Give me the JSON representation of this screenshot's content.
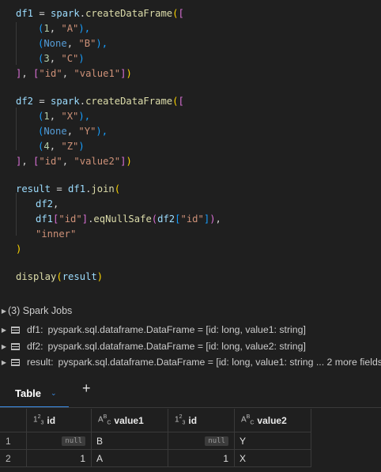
{
  "code": {
    "l1": [
      "df1",
      " = ",
      "spark",
      ".",
      "createDataFrame",
      "(",
      "["
    ],
    "l2": [
      "(",
      "1",
      ", ",
      "\"A\"",
      "),"
    ],
    "l3": [
      "(",
      "None",
      ", ",
      "\"B\"",
      "),"
    ],
    "l4": [
      "(",
      "3",
      ", ",
      "\"C\"",
      ")"
    ],
    "l5": [
      "]",
      ", ",
      "[",
      "\"id\"",
      ", ",
      "\"value1\"",
      "]",
      ")"
    ],
    "l6": [
      "df2",
      " = ",
      "spark",
      ".",
      "createDataFrame",
      "(",
      "["
    ],
    "l7": [
      "(",
      "1",
      ", ",
      "\"X\"",
      "),"
    ],
    "l8": [
      "(",
      "None",
      ", ",
      "\"Y\"",
      "),"
    ],
    "l9": [
      "(",
      "4",
      ", ",
      "\"Z\"",
      ")"
    ],
    "l10": [
      "]",
      ", ",
      "[",
      "\"id\"",
      ", ",
      "\"value2\"",
      "]",
      ")"
    ],
    "l11": [
      "result",
      " = ",
      "df1",
      ".",
      "join",
      "("
    ],
    "l12": [
      "df2",
      ","
    ],
    "l13": [
      "df1",
      "[",
      "\"id\"",
      "]",
      ".",
      "eqNullSafe",
      "(",
      "df2",
      "[",
      "\"id\"",
      "]",
      ")",
      ","
    ],
    "l14": [
      "\"inner\""
    ],
    "l15": [
      ")"
    ],
    "l16": [
      "display",
      "(",
      "result",
      ")"
    ]
  },
  "jobs": {
    "label": "(3) Spark Jobs"
  },
  "dataframes": [
    {
      "name": "df1:",
      "type": "pyspark.sql.dataframe.DataFrame = [id: long, value1: string]"
    },
    {
      "name": "df2:",
      "type": "pyspark.sql.dataframe.DataFrame = [id: long, value2: string]"
    },
    {
      "name": "result:",
      "type": "pyspark.sql.dataframe.DataFrame = [id: long, value1: string ... 2 more fields]"
    }
  ],
  "tabs": {
    "table_label": "Table",
    "add_symbol": "+"
  },
  "table": {
    "columns": [
      {
        "type_main": "1",
        "type_sup": "2",
        "type_sub": "3",
        "name": "id"
      },
      {
        "type_main": "A",
        "type_sup": "B",
        "type_sub": "C",
        "name": "value1"
      },
      {
        "type_main": "1",
        "type_sup": "2",
        "type_sub": "3",
        "name": "id"
      },
      {
        "type_main": "A",
        "type_sup": "B",
        "type_sub": "C",
        "name": "value2"
      }
    ],
    "rows": [
      {
        "num": "1",
        "id1": "null",
        "value1": "B",
        "id2": "null",
        "value2": "Y"
      },
      {
        "num": "2",
        "id1": "1",
        "value1": "A",
        "id2": "1",
        "value2": "X"
      }
    ]
  },
  "colors": {
    "background": "#1f1f1f",
    "accent": "#3b8eea",
    "string": "#ce9178",
    "variable": "#9cdcfe",
    "function": "#dcdcaa"
  }
}
